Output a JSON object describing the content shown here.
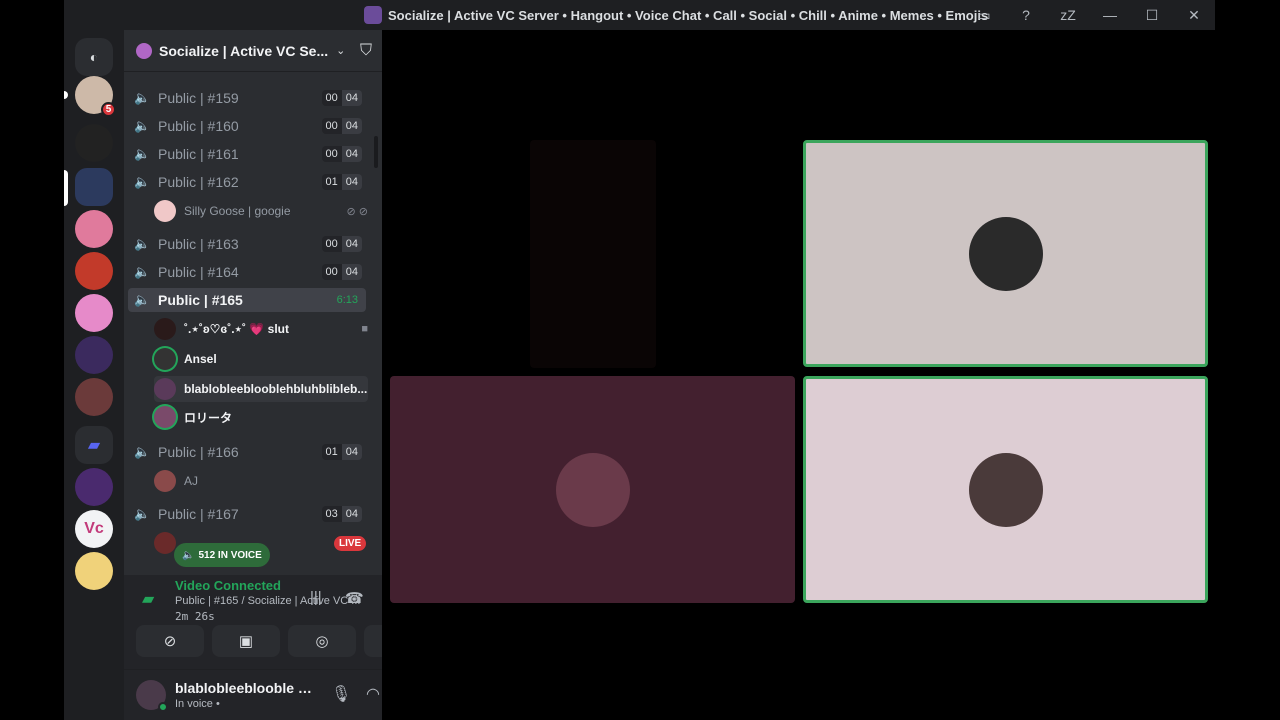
{
  "window": {
    "title": "Socialize | Active VC Server • Hangout • Voice Chat • Call • Social • Chill • Anime • Memes • Emojis",
    "controls": [
      "inbox-icon",
      "help-icon",
      "minimize",
      "maximize",
      "close"
    ]
  },
  "guilds": {
    "dm_badge": "5"
  },
  "server": {
    "name": "Socialize | Active VC Se..."
  },
  "voice_channels": [
    {
      "label": "Public | #159",
      "count_a": "00",
      "count_b": "04"
    },
    {
      "label": "Public | #160",
      "count_a": "00",
      "count_b": "04"
    },
    {
      "label": "Public | #161",
      "count_a": "00",
      "count_b": "04"
    },
    {
      "label": "Public | #162",
      "count_a": "01",
      "count_b": "04"
    },
    {
      "label": "Public | #163",
      "count_a": "00",
      "count_b": "04"
    },
    {
      "label": "Public | #164",
      "count_a": "00",
      "count_b": "04"
    },
    {
      "label": "Public | #165",
      "time": "6:13"
    },
    {
      "label": "Public | #166",
      "count_a": "01",
      "count_b": "04"
    },
    {
      "label": "Public | #167",
      "count_a": "03",
      "count_b": "04"
    }
  ],
  "users": {
    "c162_user": "Silly Goose | googie",
    "c165_user1": "˚.⋆˚ʚ♡ɞ˚.⋆˚  💗 slut",
    "c165_user2": "Ansel",
    "c165_user3": "blablobleeblooblehbluhblibleb...",
    "c165_user4": "ロリータ",
    "c166_user": "AJ"
  },
  "overlay": {
    "in_voice": "512 IN VOICE",
    "live": "LIVE"
  },
  "voice_panel": {
    "status": "Video Connected",
    "channel": "Public | #165 / Socialize | Active VC ...",
    "elapsed": "2m 26s"
  },
  "user_panel": {
    "name": "blablobleeblooble h...",
    "status": "In voice •"
  },
  "colors": {
    "accent_green": "#23a55a",
    "live_red": "#da373c",
    "sidebar_bg": "#2b2d31",
    "panel_bg": "#232428"
  }
}
